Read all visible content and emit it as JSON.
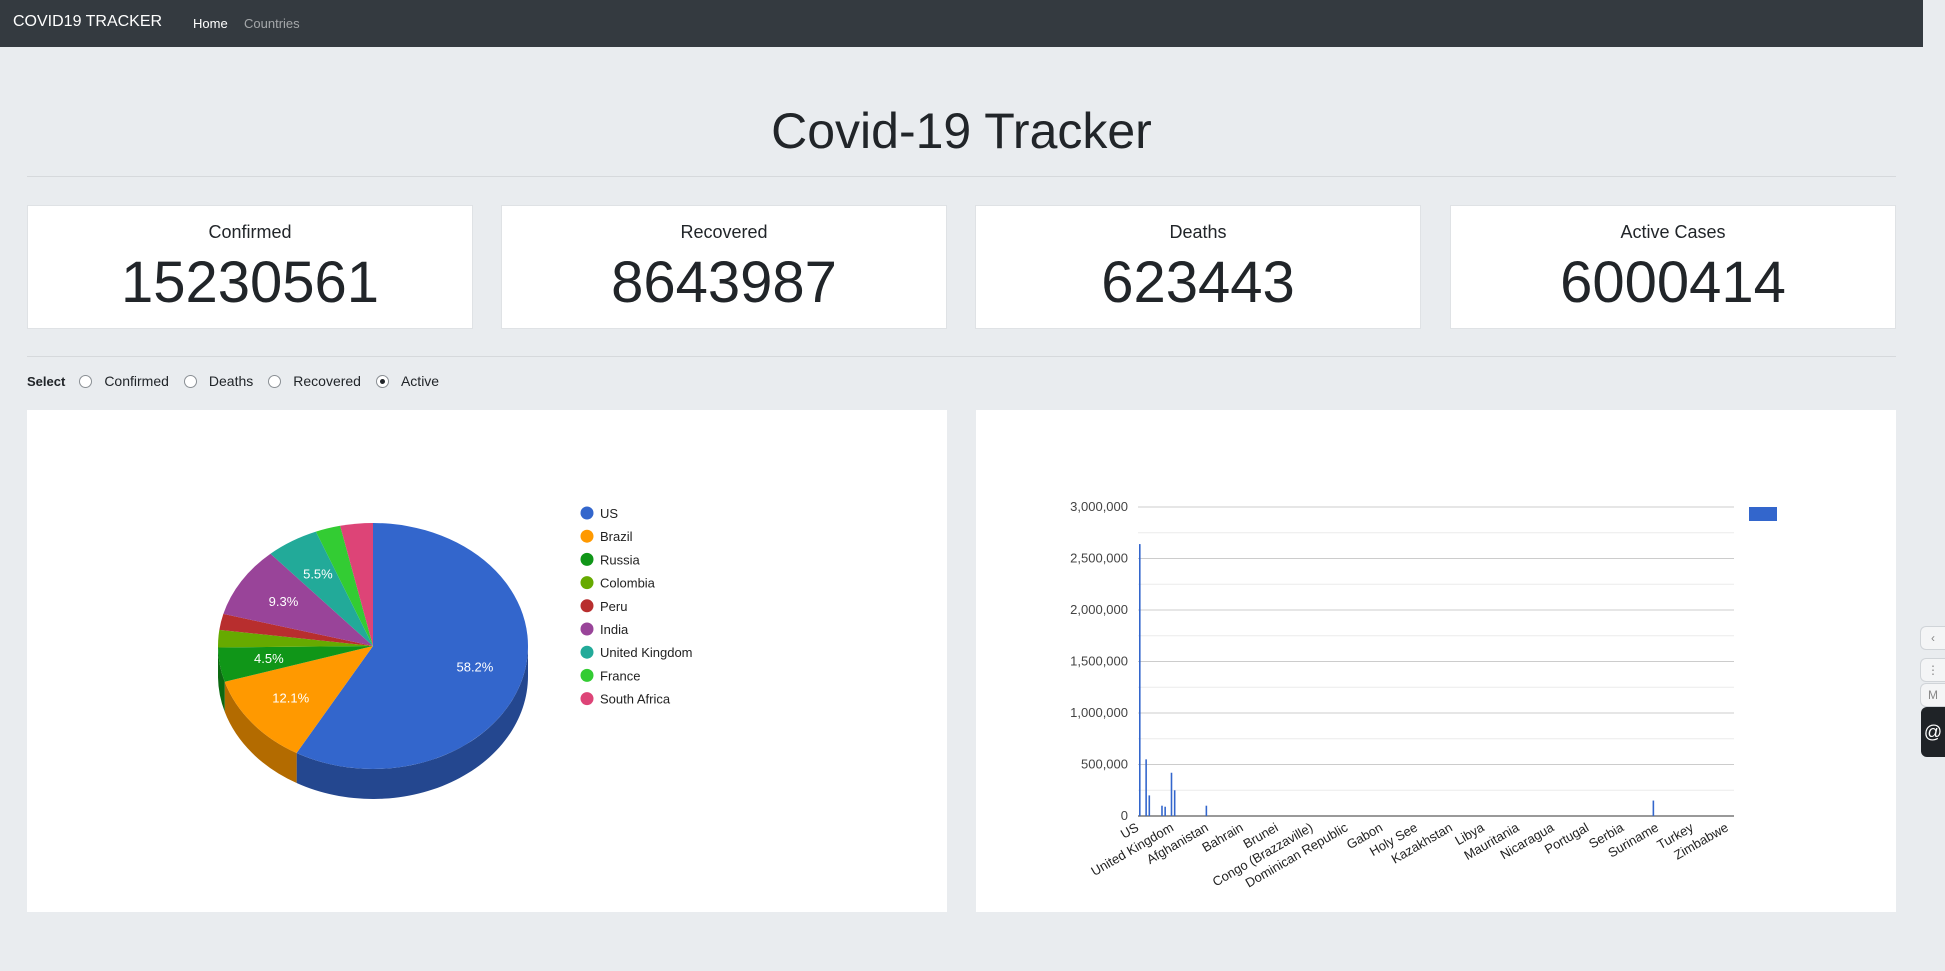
{
  "navbar": {
    "brand": "COVID19 TRACKER",
    "links": [
      {
        "label": "Home",
        "active": true
      },
      {
        "label": "Countries",
        "active": false
      }
    ]
  },
  "page_title": "Covid-19 Tracker",
  "stats": [
    {
      "title": "Confirmed",
      "value": "15230561"
    },
    {
      "title": "Recovered",
      "value": "8643987"
    },
    {
      "title": "Deaths",
      "value": "623443"
    },
    {
      "title": "Active Cases",
      "value": "6000414"
    }
  ],
  "selector": {
    "label": "Select",
    "options": [
      {
        "label": "Confirmed",
        "checked": false
      },
      {
        "label": "Deaths",
        "checked": false
      },
      {
        "label": "Recovered",
        "checked": false
      },
      {
        "label": "Active",
        "checked": true
      }
    ]
  },
  "chart_data": [
    {
      "type": "pie",
      "three_d": true,
      "legend_position": "right",
      "slices": [
        {
          "label": "US",
          "value": 58.2,
          "color": "#3366cc",
          "pct_label": "58.2%"
        },
        {
          "label": "Brazil",
          "value": 12.1,
          "color": "#ff9900",
          "pct_label": "12.1%"
        },
        {
          "label": "Russia",
          "value": 4.5,
          "color": "#109618",
          "pct_label": "4.5%"
        },
        {
          "label": "Colombia",
          "value": 2.3,
          "color": "#66aa00",
          "pct_label": ""
        },
        {
          "label": "Peru",
          "value": 2.1,
          "color": "#b82e2e",
          "pct_label": ""
        },
        {
          "label": "India",
          "value": 9.3,
          "color": "#994499",
          "pct_label": "9.3%"
        },
        {
          "label": "United Kingdom",
          "value": 5.5,
          "color": "#22aa99",
          "pct_label": "5.5%"
        },
        {
          "label": "France",
          "value": 2.6,
          "color": "#33cc33",
          "pct_label": ""
        },
        {
          "label": "South Africa",
          "value": 3.4,
          "color": "#dd4477",
          "pct_label": ""
        }
      ]
    },
    {
      "type": "bar",
      "color": "#3366cc",
      "ylim": [
        0,
        3000000
      ],
      "y_ticks": [
        "0",
        "500,000",
        "1,000,000",
        "1,500,000",
        "2,000,000",
        "2,500,000",
        "3,000,000"
      ],
      "x_tick_labels": [
        "US",
        "United Kingdom",
        "Afghanistan",
        "Bahrain",
        "Brunei",
        "Congo (Brazzaville)",
        "Dominican Republic",
        "Gabon",
        "Holy See",
        "Kazakhstan",
        "Libya",
        "Mauritania",
        "Nicaragua",
        "Portugal",
        "Serbia",
        "Suriname",
        "Turkey",
        "Zimbabwe"
      ],
      "category_count": 188,
      "values": [
        {
          "index": 0,
          "value": 2640000
        },
        {
          "index": 2,
          "value": 550000
        },
        {
          "index": 3,
          "value": 200000
        },
        {
          "index": 7,
          "value": 100000
        },
        {
          "index": 8,
          "value": 90000
        },
        {
          "index": 10,
          "value": 420000
        },
        {
          "index": 11,
          "value": 250000
        },
        {
          "index": 21,
          "value": 100000
        },
        {
          "index": 162,
          "value": 150000
        }
      ],
      "legend_position": "right"
    }
  ]
}
